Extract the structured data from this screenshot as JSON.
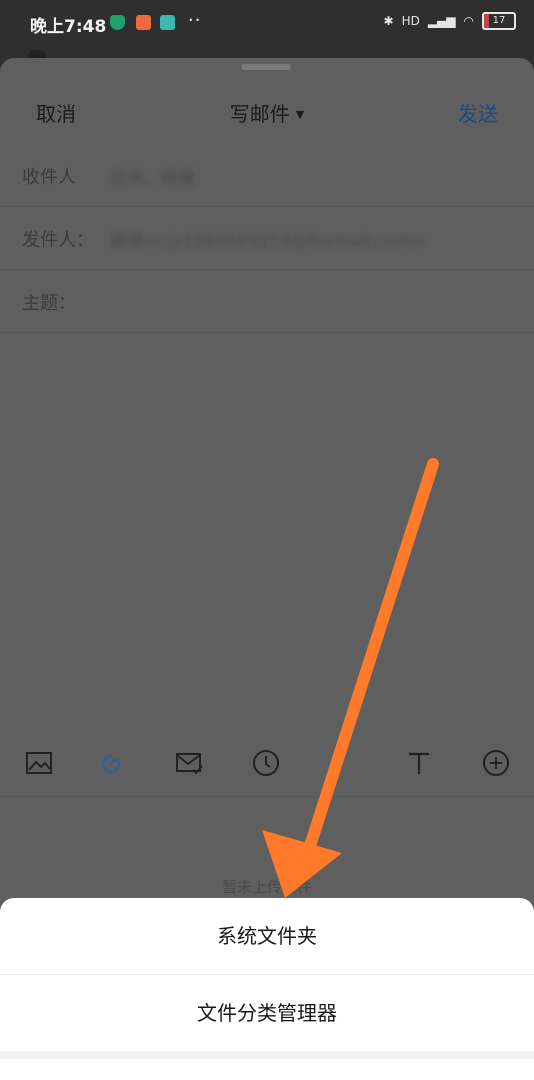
{
  "statusbar": {
    "time": "晚上7:48",
    "dots": "··",
    "network": "HD",
    "battery": "17",
    "icons": [
      "shield-icon",
      "orange-app-icon",
      "teal-app-icon",
      "bluetooth-icon",
      "signal-icon",
      "wifi-icon",
      "battery-icon"
    ]
  },
  "header": {
    "cancel": "取消",
    "title": "写邮件",
    "send": "发送"
  },
  "fields": {
    "to": {
      "label": "收件人",
      "value": "后来、眼瞳"
    },
    "from": {
      "label": "发件人：",
      "value": "静静<cjx1580589214@foxmail.com>"
    },
    "subject": {
      "label": "主题：",
      "value": ""
    }
  },
  "toolbar": {
    "icons": [
      "image-icon",
      "attachment-link-icon",
      "mail-check-icon",
      "clock-icon",
      "text-format-icon",
      "add-circle-icon"
    ]
  },
  "attachments": {
    "empty_text": "暂未上传文件"
  },
  "sheet_options": {
    "system_folder": "系统文件夹",
    "file_manager": "文件分类管理器"
  },
  "colors": {
    "send": "#1c4a86",
    "arrow": "#ff7a2a",
    "link_icon": "#2f5f9c",
    "battery": "#e05050"
  }
}
